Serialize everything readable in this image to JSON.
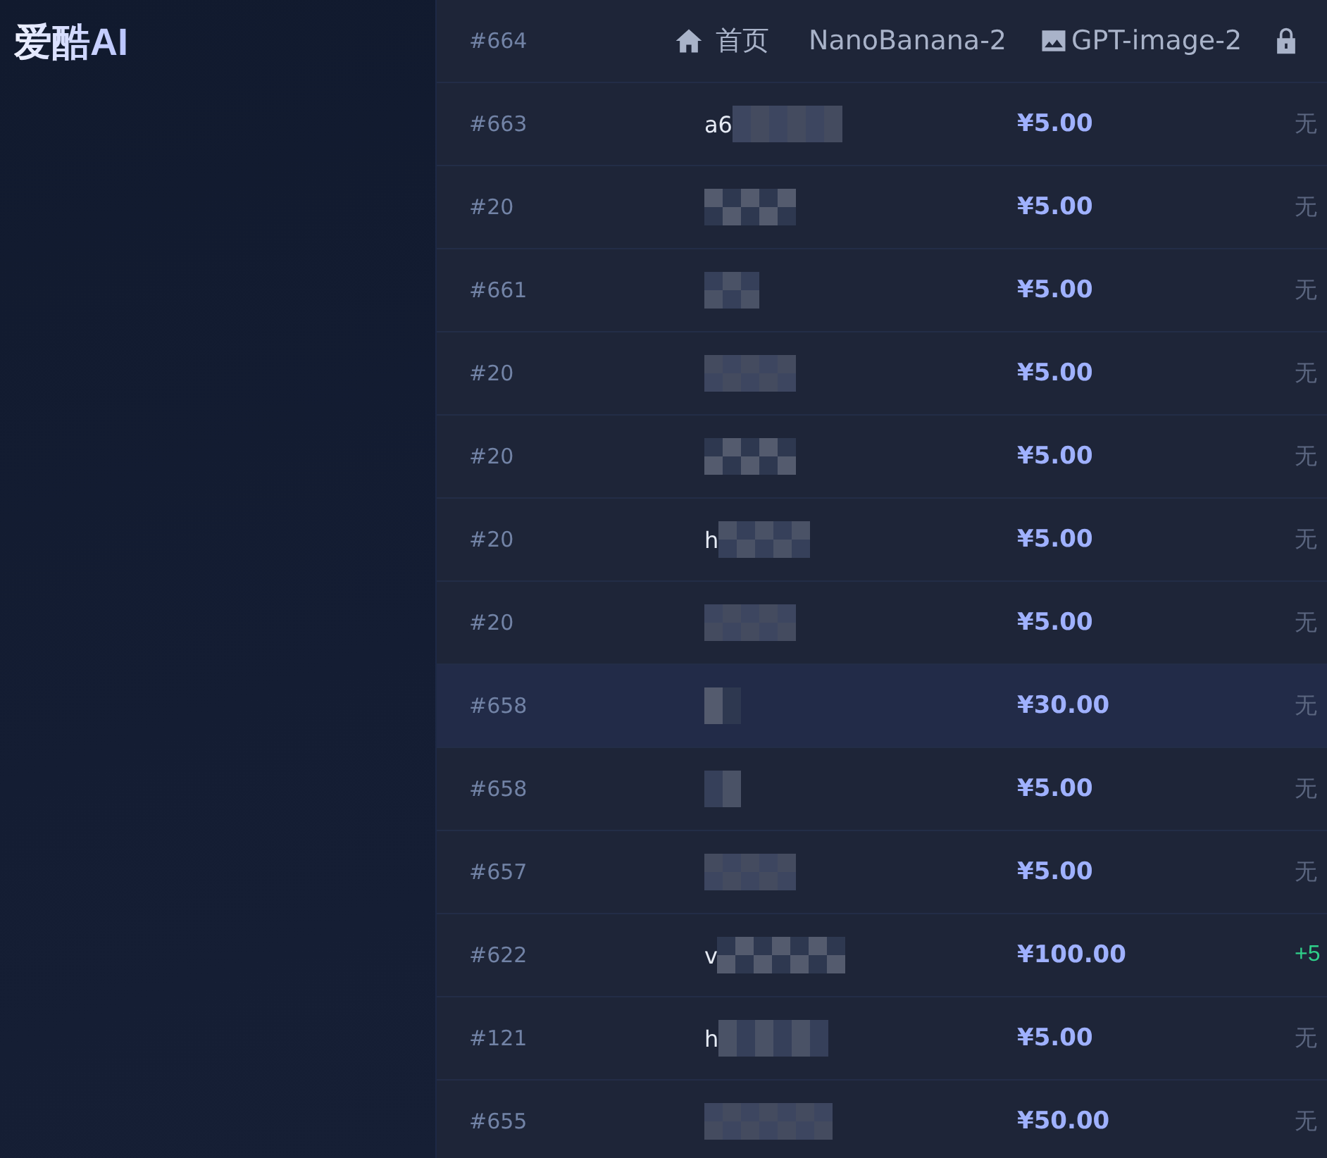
{
  "brand": {
    "name": "爱酷AI"
  },
  "nav": [
    {
      "kind": "home",
      "label": "首页"
    },
    {
      "kind": "plain",
      "label": "NanoBanana-2"
    },
    {
      "kind": "image",
      "label": "GPT-image-2"
    },
    {
      "kind": "lock"
    }
  ],
  "rows": [
    {
      "id": "#664",
      "selected": false
    },
    {
      "id": "#663",
      "user": "a6",
      "amount": "¥5.00",
      "bonus": "无",
      "kind": "none",
      "selected": false
    },
    {
      "id": "#20",
      "amount": "¥5.00",
      "bonus": "无",
      "kind": "none",
      "selected": false
    },
    {
      "id": "#661",
      "amount": "¥5.00",
      "bonus": "无",
      "kind": "none",
      "selected": false
    },
    {
      "id": "#20",
      "amount": "¥5.00",
      "bonus": "无",
      "kind": "none",
      "selected": false
    },
    {
      "id": "#20",
      "amount": "¥5.00",
      "bonus": "无",
      "kind": "none",
      "selected": false
    },
    {
      "id": "#20",
      "user": "h",
      "amount": "¥5.00",
      "bonus": "无",
      "kind": "none",
      "selected": false
    },
    {
      "id": "#20",
      "amount": "¥5.00",
      "bonus": "无",
      "kind": "none",
      "selected": false
    },
    {
      "id": "#658",
      "amount": "¥30.00",
      "bonus": "无",
      "kind": "none",
      "selected": true
    },
    {
      "id": "#658",
      "amount": "¥5.00",
      "bonus": "无",
      "kind": "none",
      "selected": false
    },
    {
      "id": "#657",
      "amount": "¥5.00",
      "bonus": "无",
      "kind": "none",
      "selected": false
    },
    {
      "id": "#622",
      "user": "v",
      "amount": "¥100.00",
      "bonus": "+5",
      "kind": "gain",
      "selected": false
    },
    {
      "id": "#121",
      "user": "h",
      "amount": "¥5.00",
      "bonus": "无",
      "kind": "none",
      "selected": false
    },
    {
      "id": "#655",
      "amount": "¥50.00",
      "bonus": "无",
      "kind": "none",
      "selected": false
    }
  ]
}
